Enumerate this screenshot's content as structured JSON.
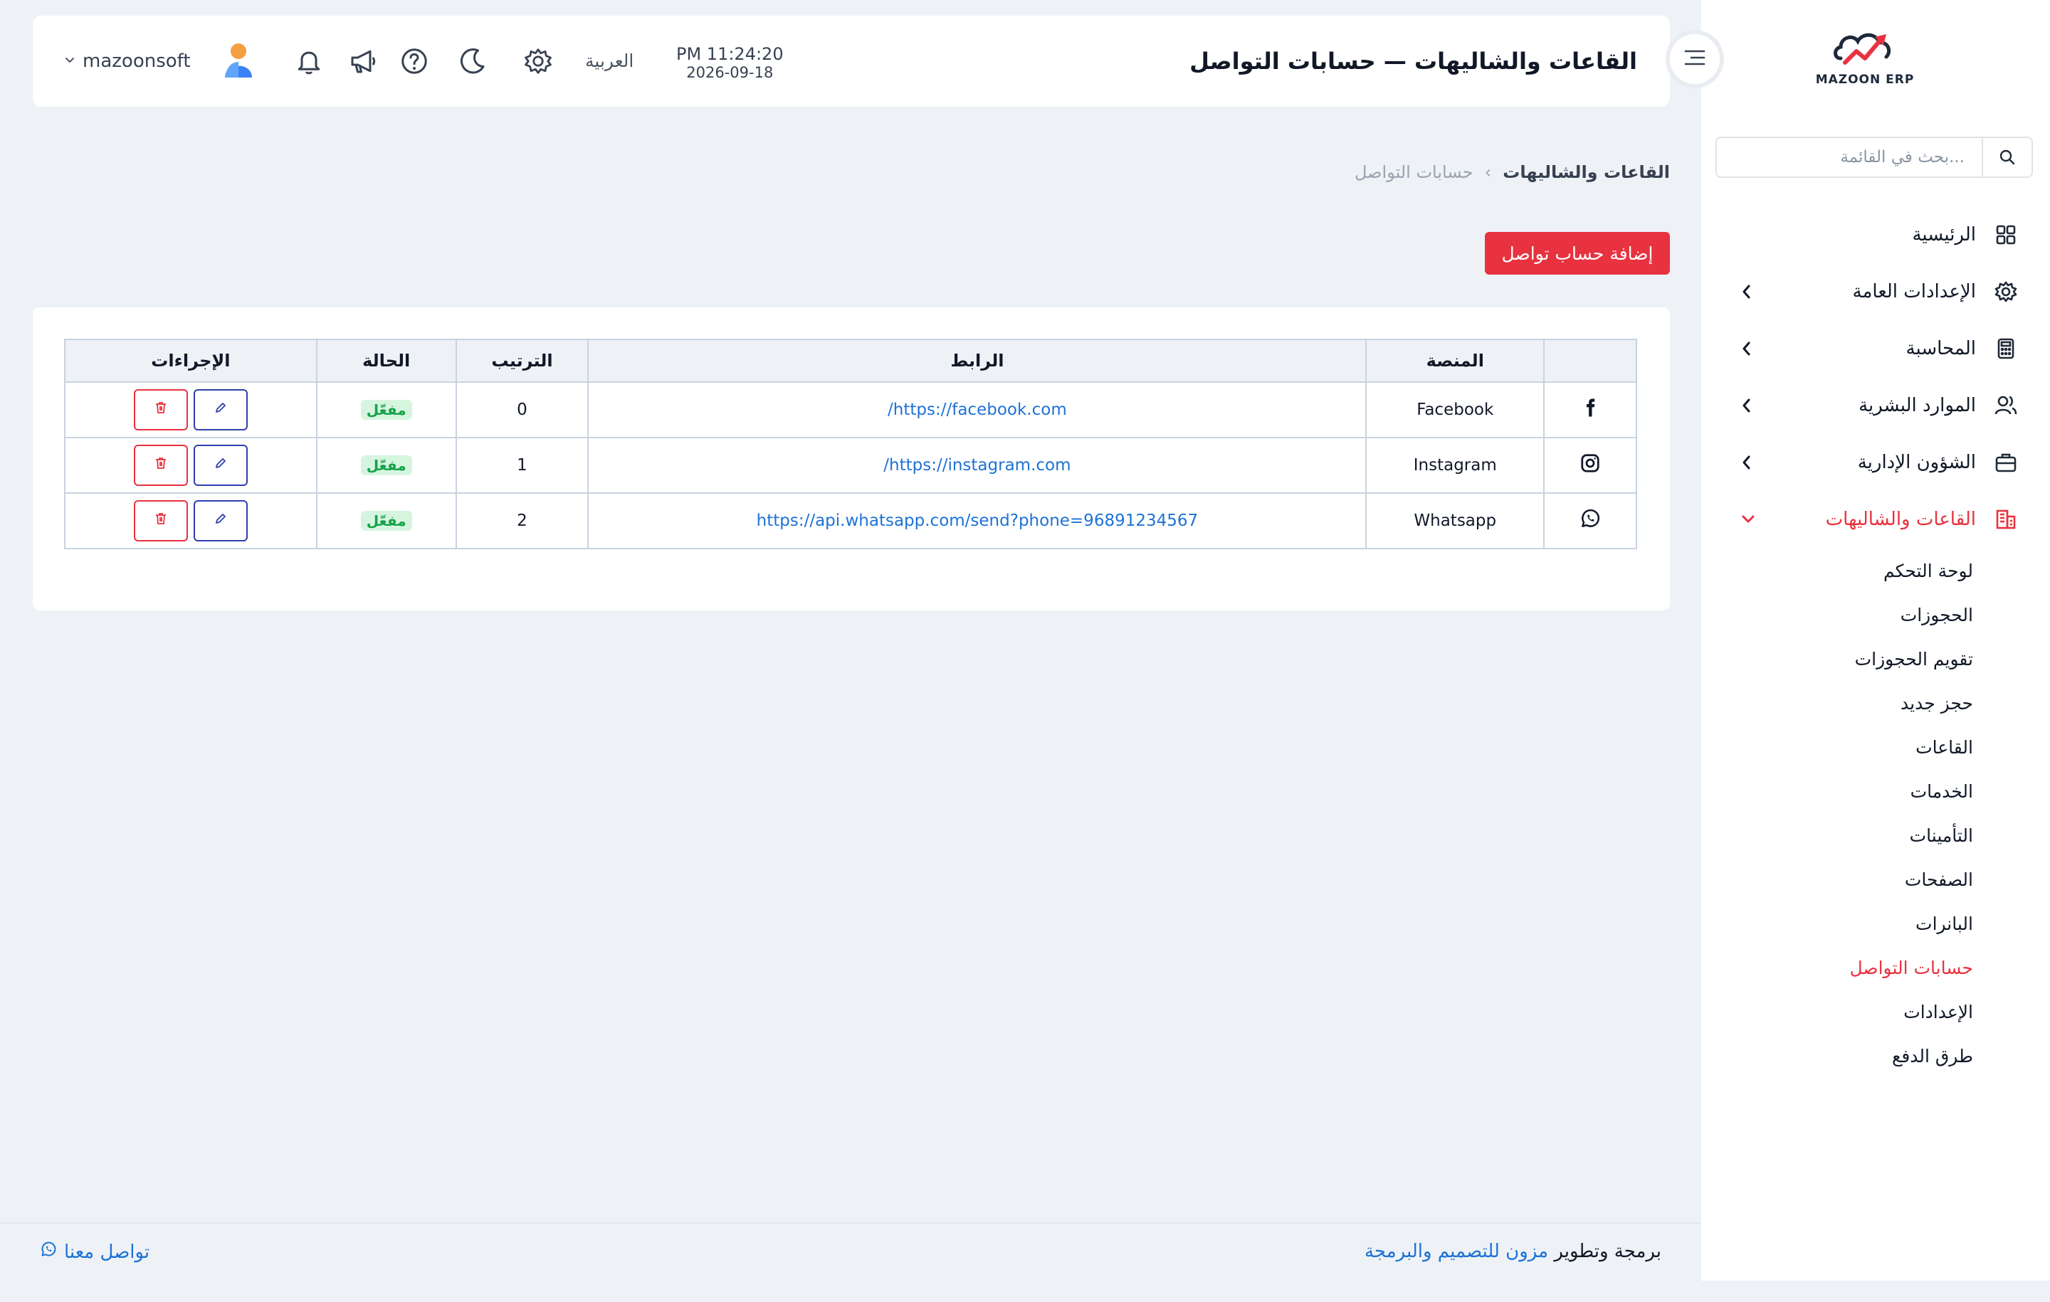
{
  "brand": {
    "logo_text": "MAZOON ERP",
    "logo_sub": "ERP.ㅤ"
  },
  "sidebar": {
    "search_placeholder": "بحث في القائمة...",
    "items": [
      {
        "label": "الرئيسية",
        "icon": "grid-icon"
      },
      {
        "label": "الإعدادات العامة",
        "icon": "gear-icon"
      },
      {
        "label": "المحاسبة",
        "icon": "calculator-icon"
      },
      {
        "label": "الموارد البشرية",
        "icon": "users-icon"
      },
      {
        "label": "الشؤون الإدارية",
        "icon": "briefcase-icon"
      },
      {
        "label": "القاعات والشاليهات",
        "icon": "building-icon"
      }
    ],
    "sub_items": [
      {
        "label": "لوحة التحكم"
      },
      {
        "label": "الحجوزات"
      },
      {
        "label": "تقويم الحجوزات"
      },
      {
        "label": "حجز جديد"
      },
      {
        "label": "القاعات"
      },
      {
        "label": "الخدمات"
      },
      {
        "label": "التأمينات"
      },
      {
        "label": "الصفحات"
      },
      {
        "label": "البانرات"
      },
      {
        "label": "حسابات التواصل"
      },
      {
        "label": "الإعدادات"
      },
      {
        "label": "طرق الدفع"
      }
    ],
    "active_color": "#e8323f"
  },
  "header": {
    "title": "القاعات والشاليهات — حسابات التواصل",
    "time": "PM 11:24:20",
    "date": "2026-09-18",
    "language": "العربية",
    "username": "mazoonsoft"
  },
  "breadcrumb": {
    "parent": "القاعات والشاليهات",
    "separator": "‹",
    "current": "حسابات التواصل"
  },
  "add_button": "إضافة حساب تواصل",
  "table": {
    "columns": [
      "",
      "المنصة",
      "الرابط",
      "الترتيب",
      "الحالة",
      "الإجراءات"
    ],
    "rows": [
      {
        "icon": "facebook-icon",
        "platform": "Facebook",
        "url": "https://facebook.com/",
        "order": "0",
        "status": "مفعّل"
      },
      {
        "icon": "instagram-icon",
        "platform": "Instagram",
        "url": "https://instagram.com/",
        "order": "1",
        "status": "مفعّل"
      },
      {
        "icon": "whatsapp-icon",
        "platform": "Whatsapp",
        "url": "https://api.whatsapp.com/send?phone=96891234567",
        "order": "2",
        "status": "مفعّل"
      }
    ]
  },
  "footer": {
    "credit_prefix": "برمجة وتطوير",
    "credit_link": "مزون للتصميم والبرمجة",
    "contact": "تواصل معنا"
  }
}
